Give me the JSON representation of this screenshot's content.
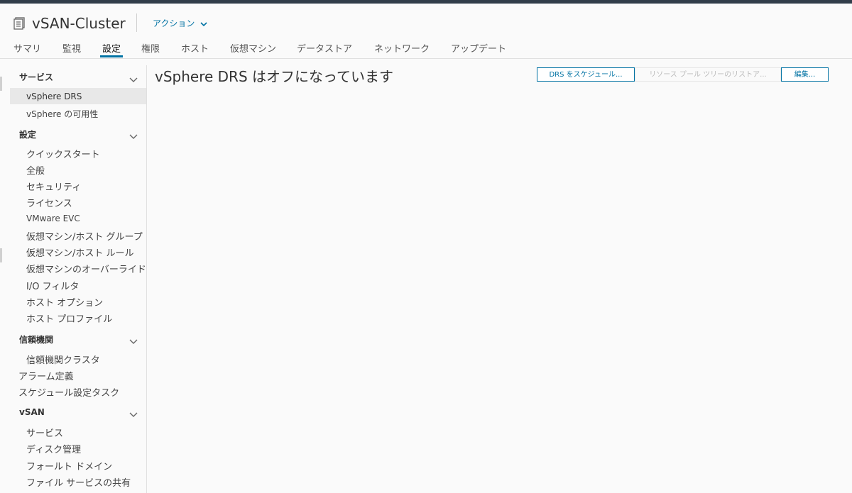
{
  "header": {
    "title": "vSAN-Cluster",
    "actions_label": "アクション",
    "icon": "cluster-icon",
    "accent_color": "#0072a3"
  },
  "tabs": [
    {
      "label": "サマリ"
    },
    {
      "label": "監視"
    },
    {
      "label": "設定",
      "active": true
    },
    {
      "label": "権限"
    },
    {
      "label": "ホスト"
    },
    {
      "label": "仮想マシン"
    },
    {
      "label": "データストア"
    },
    {
      "label": "ネットワーク"
    },
    {
      "label": "アップデート"
    }
  ],
  "sidebar": {
    "services": {
      "header": "サービス",
      "items": [
        "vSphere DRS",
        "vSphere の可用性"
      ],
      "selected": "vSphere DRS"
    },
    "settings": {
      "header": "設定",
      "items": [
        "クイックスタート",
        "全般",
        "セキュリティ",
        "ライセンス",
        "VMware EVC",
        "仮想マシン/ホスト グループ",
        "仮想マシン/ホスト ルール",
        "仮想マシンのオーバーライド",
        "I/O フィルタ",
        "ホスト オプション",
        "ホスト プロファイル"
      ]
    },
    "trust": {
      "header": "信頼機関",
      "items": [
        "信頼機関クラスタ"
      ]
    },
    "alarm_definitions": "アラーム定義",
    "scheduled_tasks": "スケジュール設定タスク",
    "vsan": {
      "header": "vSAN",
      "items": [
        "サービス",
        "ディスク管理",
        "フォールト ドメイン",
        "ファイル サービスの共有"
      ]
    }
  },
  "main": {
    "title": "vSphere DRS はオフになっています",
    "buttons": {
      "schedule_drs": "DRS をスケジュール...",
      "restore_pool": "リソース プール ツリーのリストア...",
      "edit": "編集..."
    }
  }
}
